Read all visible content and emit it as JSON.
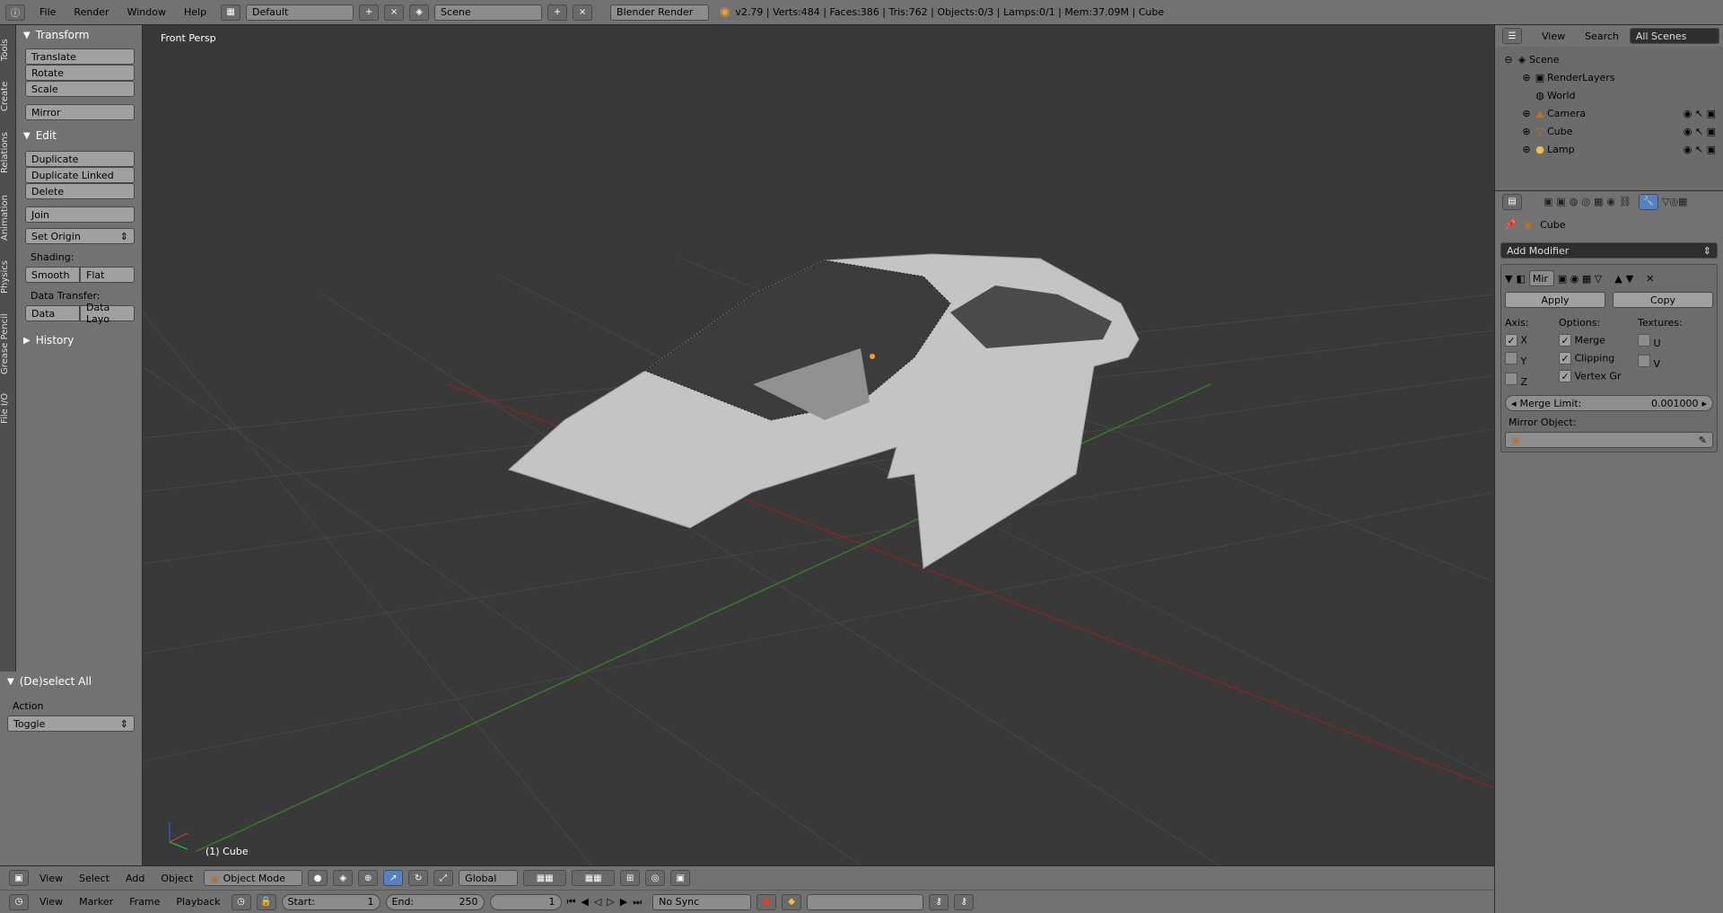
{
  "topbar": {
    "menu": [
      "File",
      "Render",
      "Window",
      "Help"
    ],
    "layout": "Default",
    "scene": "Scene",
    "engine": "Blender Render",
    "stats": "v2.79 | Verts:484 | Faces:386 | Tris:762 | Objects:0/3 | Lamps:0/1 | Mem:37.09M | Cube"
  },
  "tabs": [
    "Tools",
    "Create",
    "Relations",
    "Animation",
    "Physics",
    "Grease Pencil",
    "File I/O"
  ],
  "toolshelf": {
    "transform": "Transform",
    "translate": "Translate",
    "rotate": "Rotate",
    "scale": "Scale",
    "mirror": "Mirror",
    "edit": "Edit",
    "duplicate": "Duplicate",
    "duplicate_linked": "Duplicate Linked",
    "delete": "Delete",
    "join": "Join",
    "set_origin": "Set Origin",
    "shading": "Shading:",
    "smooth": "Smooth",
    "flat": "Flat",
    "data_transfer": "Data Transfer:",
    "data": "Data",
    "data_layo": "Data Layo",
    "history": "History"
  },
  "operator": {
    "title": "(De)select All",
    "action_label": "Action",
    "action_value": "Toggle"
  },
  "viewport": {
    "label": "Front Persp",
    "object": "(1) Cube"
  },
  "outliner": {
    "view": "View",
    "search": "Search",
    "scenes": "All Scenes",
    "items": [
      "Scene",
      "RenderLayers",
      "World",
      "Camera",
      "Cube",
      "Lamp"
    ]
  },
  "properties": {
    "object": "Cube",
    "add_modifier": "Add Modifier",
    "mod_name": "Mir",
    "apply": "Apply",
    "copy": "Copy",
    "axis": "Axis:",
    "options": "Options:",
    "textures": "Textures:",
    "x": "X",
    "y": "Y",
    "z": "Z",
    "merge": "Merge",
    "clipping": "Clipping",
    "vertex_gr": "Vertex Gr",
    "u": "U",
    "v": "V",
    "merge_limit_label": "Merge Limit:",
    "merge_limit_value": "0.001000",
    "mirror_object": "Mirror Object:"
  },
  "viewheader": {
    "menu": [
      "View",
      "Select",
      "Add",
      "Object"
    ],
    "mode": "Object Mode",
    "orientation": "Global"
  },
  "timeline": {
    "menu": [
      "View",
      "Marker",
      "Frame",
      "Playback"
    ],
    "start_label": "Start:",
    "start": "1",
    "end_label": "End:",
    "end": "250",
    "current": "1",
    "sync": "No Sync"
  },
  "colors": {
    "bg": "#393939",
    "panel": "#727272",
    "accent": "#5680c2"
  }
}
